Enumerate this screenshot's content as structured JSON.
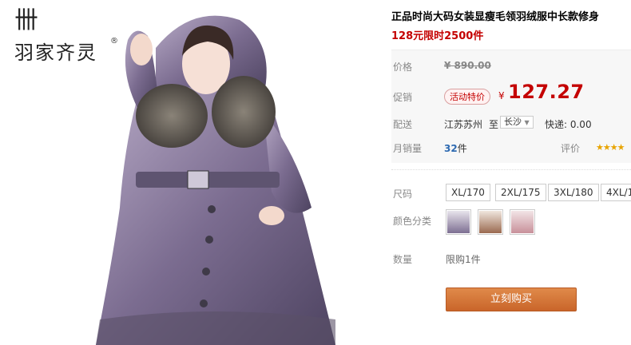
{
  "brand": {
    "mark": "卌",
    "name": "羽家齐灵",
    "registered": "®"
  },
  "product": {
    "title": "正品时尚大码女装显瘦毛领羽绒服中长款修身",
    "subtitle": "128元限时2500件"
  },
  "price": {
    "label": "价格",
    "original": "¥ 890.00",
    "promo_label": "促销",
    "promo_badge": "活动特价",
    "yen": "¥",
    "promo_price": "127.27"
  },
  "shipping": {
    "label": "配送",
    "from": "江苏苏州",
    "to_word": "至",
    "destination": "长沙",
    "express": "快递: 0.00"
  },
  "sales": {
    "label": "月销量",
    "count": "32",
    "unit": "件",
    "rating_label": "评价",
    "stars": "★★★★"
  },
  "size": {
    "label": "尺码",
    "options": [
      "XL/170",
      "2XL/175",
      "3XL/180",
      "4XL/1"
    ]
  },
  "color": {
    "label": "颜色分类"
  },
  "quantity": {
    "label": "数量",
    "limit": "限购1件"
  },
  "buy_button": "立刻购买",
  "colors": {
    "accent": "#c40000",
    "link": "#2e6ab1",
    "button": "#d0702f",
    "coat_purple": "#7d6f92"
  }
}
